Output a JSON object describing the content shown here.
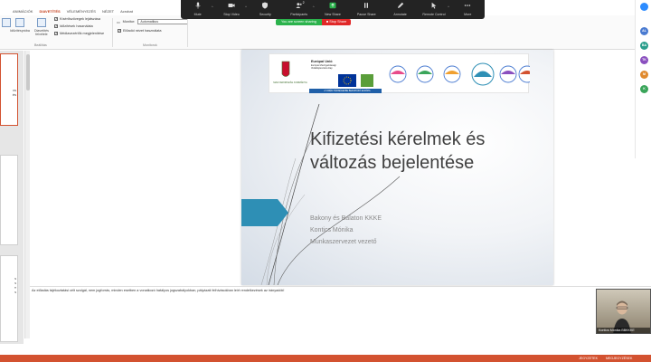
{
  "ribbon": {
    "tabs": [
      "ANIMÁCIÓK",
      "DIAVETÍTÉS",
      "VÉLEMÉNYEZÉS",
      "NÉZET",
      "Acrobat"
    ],
    "active_tab": "DIAVETÍTÉS",
    "buttons": [
      {
        "label": "Időzítéspróba"
      },
      {
        "label": "Diavetítés felvétele"
      }
    ],
    "checks": [
      {
        "label": "Kísérőszövegek lejátszása",
        "checked": true
      },
      {
        "label": "Időzítések használata",
        "checked": true
      },
      {
        "label": "Médiavezérlők megjelenítése",
        "checked": true
      }
    ],
    "group_setup_label": "Beállítás",
    "monitor_label": "Monitor:",
    "monitor_value": "Automatikus",
    "presenter_view_label": "Előadói nézet használata",
    "group_monitors_label": "Monitorok"
  },
  "thumbnails": {
    "slide1_text": "vs\nés",
    "slide3_text": "s\ns\n≡\ns"
  },
  "slide": {
    "title_line1": "Kifizetési kérelmek és",
    "title_line2": "változás bejelentése",
    "subtitle": [
      "Bakony és Balaton KKKE",
      "Kontics Mónika",
      "Munkaszervezet vezető"
    ],
    "logos": {
      "gov": "MAGYARORSZÁG KORMÁNYA",
      "eu_title": "Európai Unió",
      "eu_sub": "Európai Mezőgazdasági Vidékfejlesztési Alap",
      "banner": "A VIDÉKI TÉRSÉGEKBE BERUHÁZÓ EURÓPA"
    },
    "colors": {
      "arrow": "#2e8fb5",
      "title": "#404040"
    }
  },
  "notes": {
    "text": "Az előadás tájékoztatási célt szolgál, nem jogforrás, minden esetben a vonatkozó hatályos jogszabályokban, pályázati felhívásokban leírt rendelkezések az irányadók!"
  },
  "statusbar": {
    "notes_label": "JEGYZETEK",
    "comments_label": "MEGJEGYZÉSEK",
    "color": "#d35230"
  },
  "zoom": {
    "toolbar": [
      {
        "label": "Mute",
        "icon": "microphone-icon",
        "caret": true
      },
      {
        "label": "Stop Video",
        "icon": "video-camera-icon",
        "caret": true
      },
      {
        "label": "Security",
        "icon": "shield-icon",
        "caret": false
      },
      {
        "label": "Participants",
        "icon": "participants-icon",
        "caret": true,
        "badge": "2"
      },
      {
        "label": "New Share",
        "icon": "share-screen-icon",
        "caret": false
      },
      {
        "label": "Pause Share",
        "icon": "pause-icon",
        "caret": false
      },
      {
        "label": "Annotate",
        "icon": "annotate-pen-icon",
        "caret": false
      },
      {
        "label": "Remote Control",
        "icon": "remote-control-icon",
        "caret": true
      },
      {
        "label": "More",
        "icon": "more-dots-icon",
        "caret": false
      }
    ],
    "sharing_text": "You are screen sharing",
    "stop_share_label": "Stop Share"
  },
  "chat": {
    "avatars": [
      {
        "initials": "",
        "color": "#2d8cff"
      },
      {
        "initials": "AL",
        "color": "#4a7bd1"
      },
      {
        "initials": "BA",
        "color": "#2a9e8c"
      },
      {
        "initials": "TK",
        "color": "#8a4fbf"
      },
      {
        "initials": "M",
        "color": "#e08a2e"
      },
      {
        "initials": "K",
        "color": "#3aa55a"
      }
    ]
  },
  "video": {
    "name": "Kontics Mónika BBKKKE"
  }
}
